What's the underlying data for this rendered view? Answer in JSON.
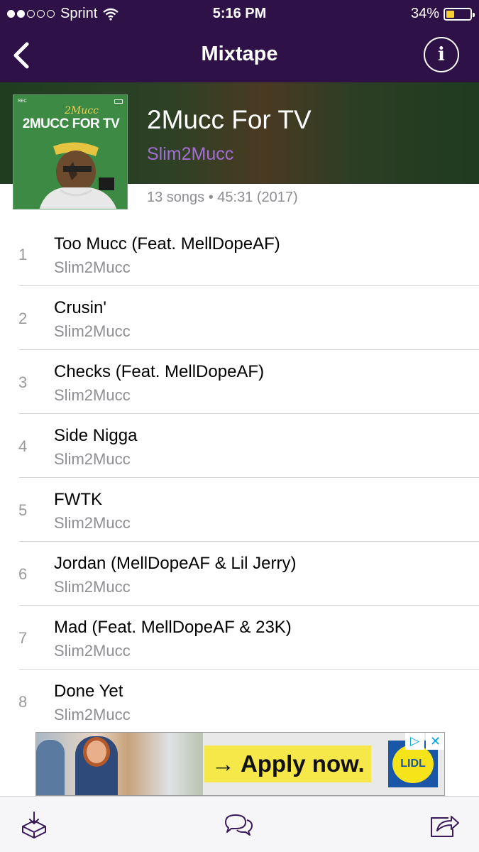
{
  "status_bar": {
    "signal_dots_filled": 2,
    "signal_dots_total": 5,
    "carrier": "Sprint",
    "time": "5:16 PM",
    "battery_percent": "34%",
    "battery_level": 0.34
  },
  "nav": {
    "back_icon": "chevron-left-icon",
    "title": "Mixtape",
    "info_glyph": "i"
  },
  "album": {
    "title": "2Mucc For TV",
    "artist": "Slim2Mucc",
    "meta": "13 songs • 45:31 (2017)",
    "cover": {
      "script_text": "2Mucc",
      "title_text": "2MUCC FOR TV",
      "rec_text": "REC"
    }
  },
  "tracks": [
    {
      "num": "1",
      "title": "Too Mucc (Feat. MellDopeAF)",
      "artist": "Slim2Mucc"
    },
    {
      "num": "2",
      "title": "Crusin'",
      "artist": "Slim2Mucc"
    },
    {
      "num": "3",
      "title": "Checks (Feat. MellDopeAF)",
      "artist": "Slim2Mucc"
    },
    {
      "num": "4",
      "title": "Side Nigga",
      "artist": "Slim2Mucc"
    },
    {
      "num": "5",
      "title": "FWTK",
      "artist": "Slim2Mucc"
    },
    {
      "num": "6",
      "title": "Jordan (MellDopeAF & Lil Jerry)",
      "artist": "Slim2Mucc"
    },
    {
      "num": "7",
      "title": "Mad (Feat. MellDopeAF & 23K)",
      "artist": "Slim2Mucc"
    },
    {
      "num": "8",
      "title": "Done Yet",
      "artist": "Slim2Mucc"
    }
  ],
  "ad": {
    "cta": "→ Apply now.",
    "logo_text": "LIDL",
    "adchoices_glyph": "▷",
    "close_glyph": "✕"
  },
  "toolbar": {
    "download_icon": "download-box-icon",
    "chat_icon": "chat-bubbles-icon",
    "share_icon": "share-icon"
  },
  "colors": {
    "nav_bg": "#2e1147",
    "artist_accent": "#a26ed4",
    "battery_fill": "#f7cf2f"
  }
}
